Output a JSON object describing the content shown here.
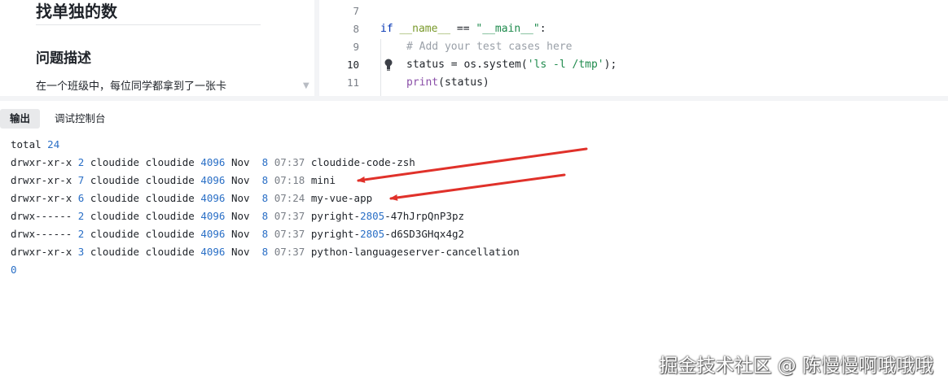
{
  "problem": {
    "title": "找单独的数",
    "heading": "问题描述",
    "text": "在一个班级中，每位同学都拿到了一张卡"
  },
  "editor": {
    "lines": [
      {
        "num": "7"
      },
      {
        "num": "8",
        "kw": "if",
        "dunder": "__name__",
        "op": " == ",
        "str": "\"__main__\"",
        "tail": ":"
      },
      {
        "num": "9",
        "comment": "# Add your test cases here"
      },
      {
        "num": "10",
        "pre": "status = os.system(",
        "str": "'ls -l /tmp'",
        "tail": ");"
      },
      {
        "num": "11",
        "builtin": "print",
        "tail": "(status)"
      }
    ]
  },
  "tabs": [
    {
      "label": "输出",
      "active": true
    },
    {
      "label": "调试控制台",
      "active": false
    }
  ],
  "output": {
    "total_label": "total",
    "total_value": "24",
    "rows": [
      {
        "perms": "drwxr-xr-x",
        "links": "2",
        "owner": "cloudide",
        "group": "cloudide",
        "size": "4096",
        "month": "Nov",
        "day": "8",
        "time": "07:37",
        "name": "cloudide-code-zsh"
      },
      {
        "perms": "drwxr-xr-x",
        "links": "7",
        "owner": "cloudide",
        "group": "cloudide",
        "size": "4096",
        "month": "Nov",
        "day": "8",
        "time": "07:18",
        "name": "mini"
      },
      {
        "perms": "drwxr-xr-x",
        "links": "6",
        "owner": "cloudide",
        "group": "cloudide",
        "size": "4096",
        "month": "Nov",
        "day": "8",
        "time": "07:24",
        "name": "my-vue-app"
      },
      {
        "perms": "drwx------",
        "links": "2",
        "owner": "cloudide",
        "group": "cloudide",
        "size": "4096",
        "month": "Nov",
        "day": "8",
        "time": "07:37",
        "name_pre": "pyright-",
        "name_num": "2805",
        "name_post": "-47hJrpQnP3pz"
      },
      {
        "perms": "drwx------",
        "links": "2",
        "owner": "cloudide",
        "group": "cloudide",
        "size": "4096",
        "month": "Nov",
        "day": "8",
        "time": "07:37",
        "name_pre": "pyright-",
        "name_num": "2805",
        "name_post": "-d6SD3GHqx4g2"
      },
      {
        "perms": "drwxr-xr-x",
        "links": "3",
        "owner": "cloudide",
        "group": "cloudide",
        "size": "4096",
        "month": "Nov",
        "day": "8",
        "time": "07:37",
        "name": "python-languageserver-cancellation"
      }
    ],
    "exit_code": "0"
  },
  "colors": {
    "arrow": "#e0312a",
    "number": "#2a6fc6"
  },
  "watermark": "掘金技术社区 @ 陈慢慢啊哦哦哦"
}
